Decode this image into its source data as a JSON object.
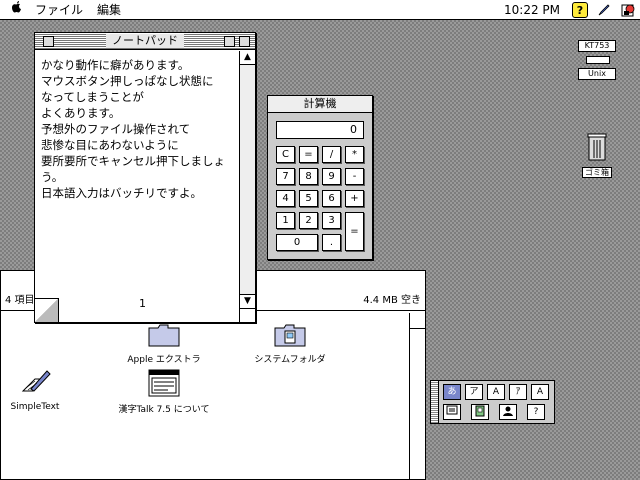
{
  "menubar": {
    "apple_glyph": "",
    "items": [
      "ファイル",
      "編集"
    ],
    "clock": "10:22 PM",
    "help_glyph": "?"
  },
  "notepad": {
    "title": "ノートパッド",
    "lines": [
      "かなり動作に癖があります。",
      "マウスボタン押しっぱなし状態に",
      "なってしまうことが",
      "よくあります。",
      "予想外のファイル操作されて",
      "悲惨な目にあわないように",
      "要所要所でキャンセル押下しましょ",
      "う。",
      "日本語入力はバッチリですよ。"
    ],
    "page_number": "1"
  },
  "calculator": {
    "title": "計算機",
    "display": "0",
    "keys": {
      "c": "C",
      "eq_top": "=",
      "div": "/",
      "mul": "*",
      "k7": "7",
      "k8": "8",
      "k9": "9",
      "minus": "-",
      "k4": "4",
      "k5": "5",
      "k6": "6",
      "plus": "+",
      "k1": "1",
      "k2": "2",
      "k3": "3",
      "k0": "0",
      "dot": ".",
      "enter": "="
    }
  },
  "desktop_window": {
    "item_count": "4 項目",
    "free_space": "4.4 MB 空き",
    "items": [
      {
        "label": "Apple エクストラ",
        "icon": "folder-icon"
      },
      {
        "label": "システムフォルダ",
        "icon": "system-folder-icon"
      },
      {
        "label": "SimpleText",
        "icon": "simpletext-icon"
      },
      {
        "label": "漢字Talk 7.5 について",
        "icon": "document-icon"
      }
    ]
  },
  "keyboard_widget": {
    "top_label": "KT753",
    "bottom_label": "Unix"
  },
  "trash": {
    "label": "ゴミ箱",
    "icon": "trash-icon"
  },
  "ime_palette": {
    "row1": [
      "あ",
      "ア",
      "A",
      "ｱ",
      "A"
    ],
    "row2_icons": [
      "dictionary-icon",
      "book-icon",
      "user-icon",
      "help-icon"
    ],
    "help_glyph": "?"
  },
  "colors": {
    "desktop": "#9a9a9a",
    "ime_selected": "#7986cb",
    "help_icon": "#ffeb3b"
  }
}
